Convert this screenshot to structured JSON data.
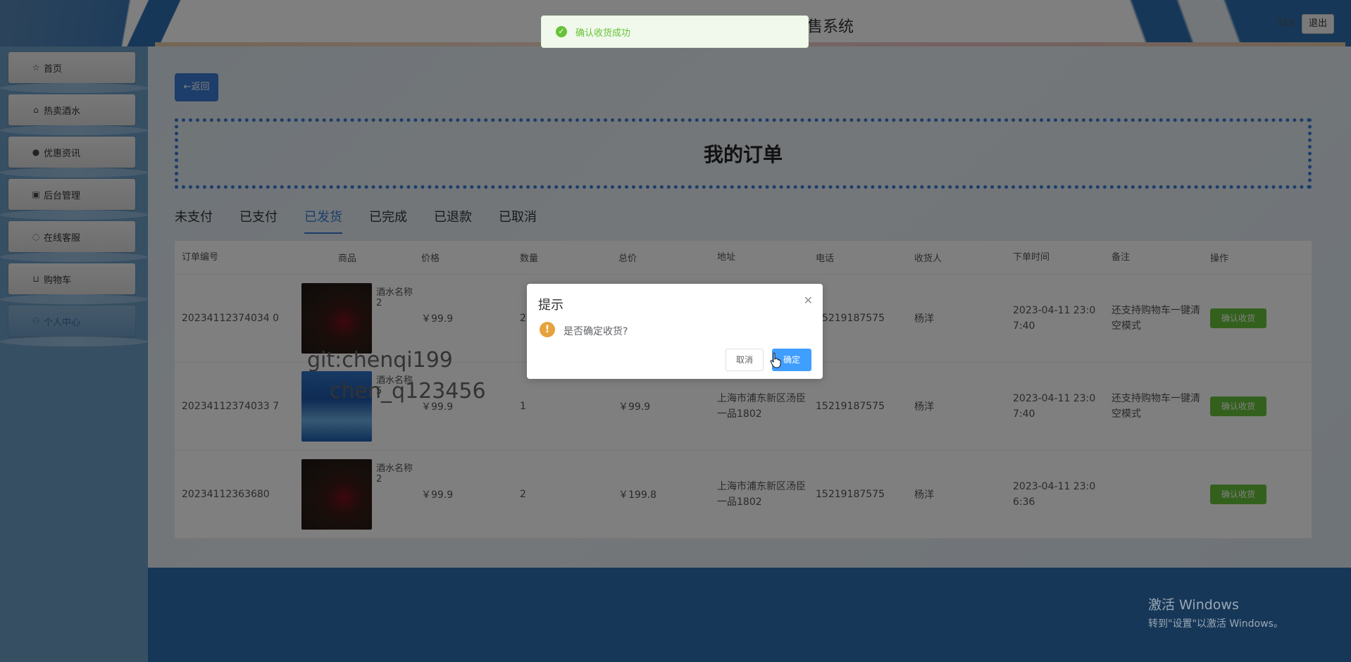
{
  "header": {
    "site_title": "售系统",
    "user": "333",
    "logout_label": "退出"
  },
  "toast": {
    "message": "确认收货成功"
  },
  "sidebar": {
    "items": [
      {
        "icon": "star-icon",
        "glyph": "☆",
        "label": "首页"
      },
      {
        "icon": "bag-icon",
        "glyph": "⌂",
        "label": "热卖酒水"
      },
      {
        "icon": "info-icon",
        "glyph": "●",
        "label": "优惠资讯"
      },
      {
        "icon": "gift-icon",
        "glyph": "▣",
        "label": "后台管理"
      },
      {
        "icon": "headset-icon",
        "glyph": "◌",
        "label": "在线客服"
      },
      {
        "icon": "cart-icon",
        "glyph": "⊔",
        "label": "购物车"
      },
      {
        "icon": "user-icon",
        "glyph": "⚇",
        "label": "个人中心"
      }
    ]
  },
  "main": {
    "back_label": "←返回",
    "title": "我的订单",
    "tabs": [
      "未支付",
      "已支付",
      "已发货",
      "已完成",
      "已退款",
      "已取消"
    ],
    "active_tab": "已发货",
    "columns": [
      "订单编号",
      "商品",
      "价格",
      "数量",
      "总价",
      "地址",
      "电话",
      "收货人",
      "下单时间",
      "备注",
      "操作"
    ],
    "rows": [
      {
        "id": "20234112374034 0",
        "goods": "酒水名称2",
        "image": "wine",
        "price": "￥99.9",
        "qty": "2",
        "total": "",
        "address": "",
        "phone": "15219187575",
        "receiver": "杨洋",
        "time": "2023-04-11 23:0 7:40",
        "note": "还支持购物车一键清空模式",
        "action": "确认收货"
      },
      {
        "id": "20234112374033 7",
        "goods": "酒水名称5",
        "image": "cocktail",
        "price": "￥99.9",
        "qty": "1",
        "total": "￥99.9",
        "address": "上海市浦东新区汤臣一品1802",
        "phone": "15219187575",
        "receiver": "杨洋",
        "time": "2023-04-11 23:0 7:40",
        "note": "还支持购物车一键清空模式",
        "action": "确认收货"
      },
      {
        "id": "20234112363680",
        "goods": "酒水名称2",
        "image": "wine",
        "price": "￥99.9",
        "qty": "2",
        "total": "￥199.8",
        "address": "上海市浦东新区汤臣一品1802",
        "phone": "15219187575",
        "receiver": "杨洋",
        "time": "2023-04-11 23:0 6:36",
        "note": "",
        "action": "确认收货"
      }
    ]
  },
  "modal": {
    "title": "提示",
    "message": "是否确定收货?",
    "cancel_label": "取消",
    "ok_label": "确定"
  },
  "watermark": {
    "line1": "git:chenqi199",
    "line2": "chen_q123456"
  },
  "windows_activation": {
    "title": "激活 Windows",
    "subtitle": "转到\"设置\"以激活 Windows。"
  },
  "colors": {
    "primary": "#3a7bd5",
    "success": "#67c23a",
    "warning": "#e6a23c",
    "modal_ok": "#409eff"
  }
}
